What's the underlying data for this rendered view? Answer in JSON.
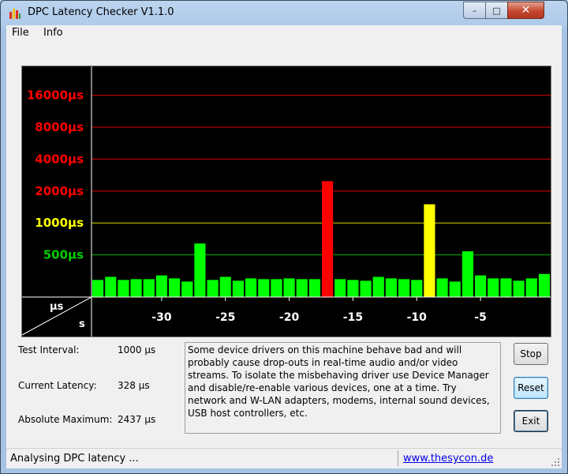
{
  "window": {
    "title": "DPC Latency Checker V1.1.0",
    "min_glyph": "–",
    "max_glyph": "□",
    "close_glyph": "✕"
  },
  "menu": {
    "items": [
      "File",
      "Info"
    ]
  },
  "chart_data": {
    "type": "bar",
    "yscale": "log",
    "ylim": [
      200,
      30000
    ],
    "y_ticks": [
      {
        "label": "16000µs",
        "value": 16000,
        "color": "#ff0000"
      },
      {
        "label": "8000µs",
        "value": 8000,
        "color": "#ff0000"
      },
      {
        "label": "4000µs",
        "value": 4000,
        "color": "#ff0000"
      },
      {
        "label": "2000µs",
        "value": 2000,
        "color": "#ff0000"
      },
      {
        "label": "1000µs",
        "value": 1000,
        "color": "#ffff00"
      },
      {
        "label": "500µs",
        "value": 500,
        "color": "#00cc00"
      }
    ],
    "x_ticks": [
      -30,
      -25,
      -20,
      -15,
      -10,
      -5
    ],
    "x_ticks_text": [
      "-30",
      "-25",
      "-20",
      "-15",
      "-10",
      "-5"
    ],
    "xlim": [
      -35.5,
      0.5
    ],
    "unit_label": "µs",
    "axis_label": "s",
    "x": [
      -35,
      -34,
      -33,
      -32,
      -31,
      -30,
      -29,
      -28,
      -27,
      -26,
      -25,
      -24,
      -23,
      -22,
      -21,
      -20,
      -19,
      -18,
      -17,
      -16,
      -15,
      -14,
      -13,
      -12,
      -11,
      -10,
      -9,
      -8,
      -7,
      -6,
      -5,
      -4,
      -3,
      -2,
      -1,
      0
    ],
    "values": [
      290,
      310,
      290,
      295,
      295,
      320,
      300,
      280,
      640,
      290,
      310,
      285,
      300,
      295,
      295,
      300,
      295,
      295,
      2480,
      295,
      290,
      285,
      310,
      300,
      295,
      290,
      1500,
      300,
      280,
      540,
      320,
      300,
      300,
      285,
      300,
      330
    ],
    "colors": {
      "green": "#00ff00",
      "yellow": "#ffff00",
      "red": "#ff0000",
      "yellow_threshold": 1000,
      "red_threshold": 2000
    }
  },
  "fields": {
    "test_interval": {
      "label": "Test Interval:",
      "value": "1000 µs"
    },
    "current_latency": {
      "label": "Current Latency:",
      "value": "328 µs"
    },
    "absolute_maximum": {
      "label": "Absolute Maximum:",
      "value": "2437 µs"
    }
  },
  "info_text": "Some device drivers on this machine behave bad and will probably cause drop-outs in real-time audio and/or video streams. To isolate the misbehaving driver use Device Manager and disable/re-enable various devices, one at a time. Try network and W-LAN adapters, modems, internal sound devices, USB host controllers, etc.",
  "buttons": {
    "stop": "Stop",
    "reset": "Reset",
    "exit": "Exit"
  },
  "status": {
    "text": "Analysing DPC latency ...",
    "link": "www.thesycon.de"
  }
}
